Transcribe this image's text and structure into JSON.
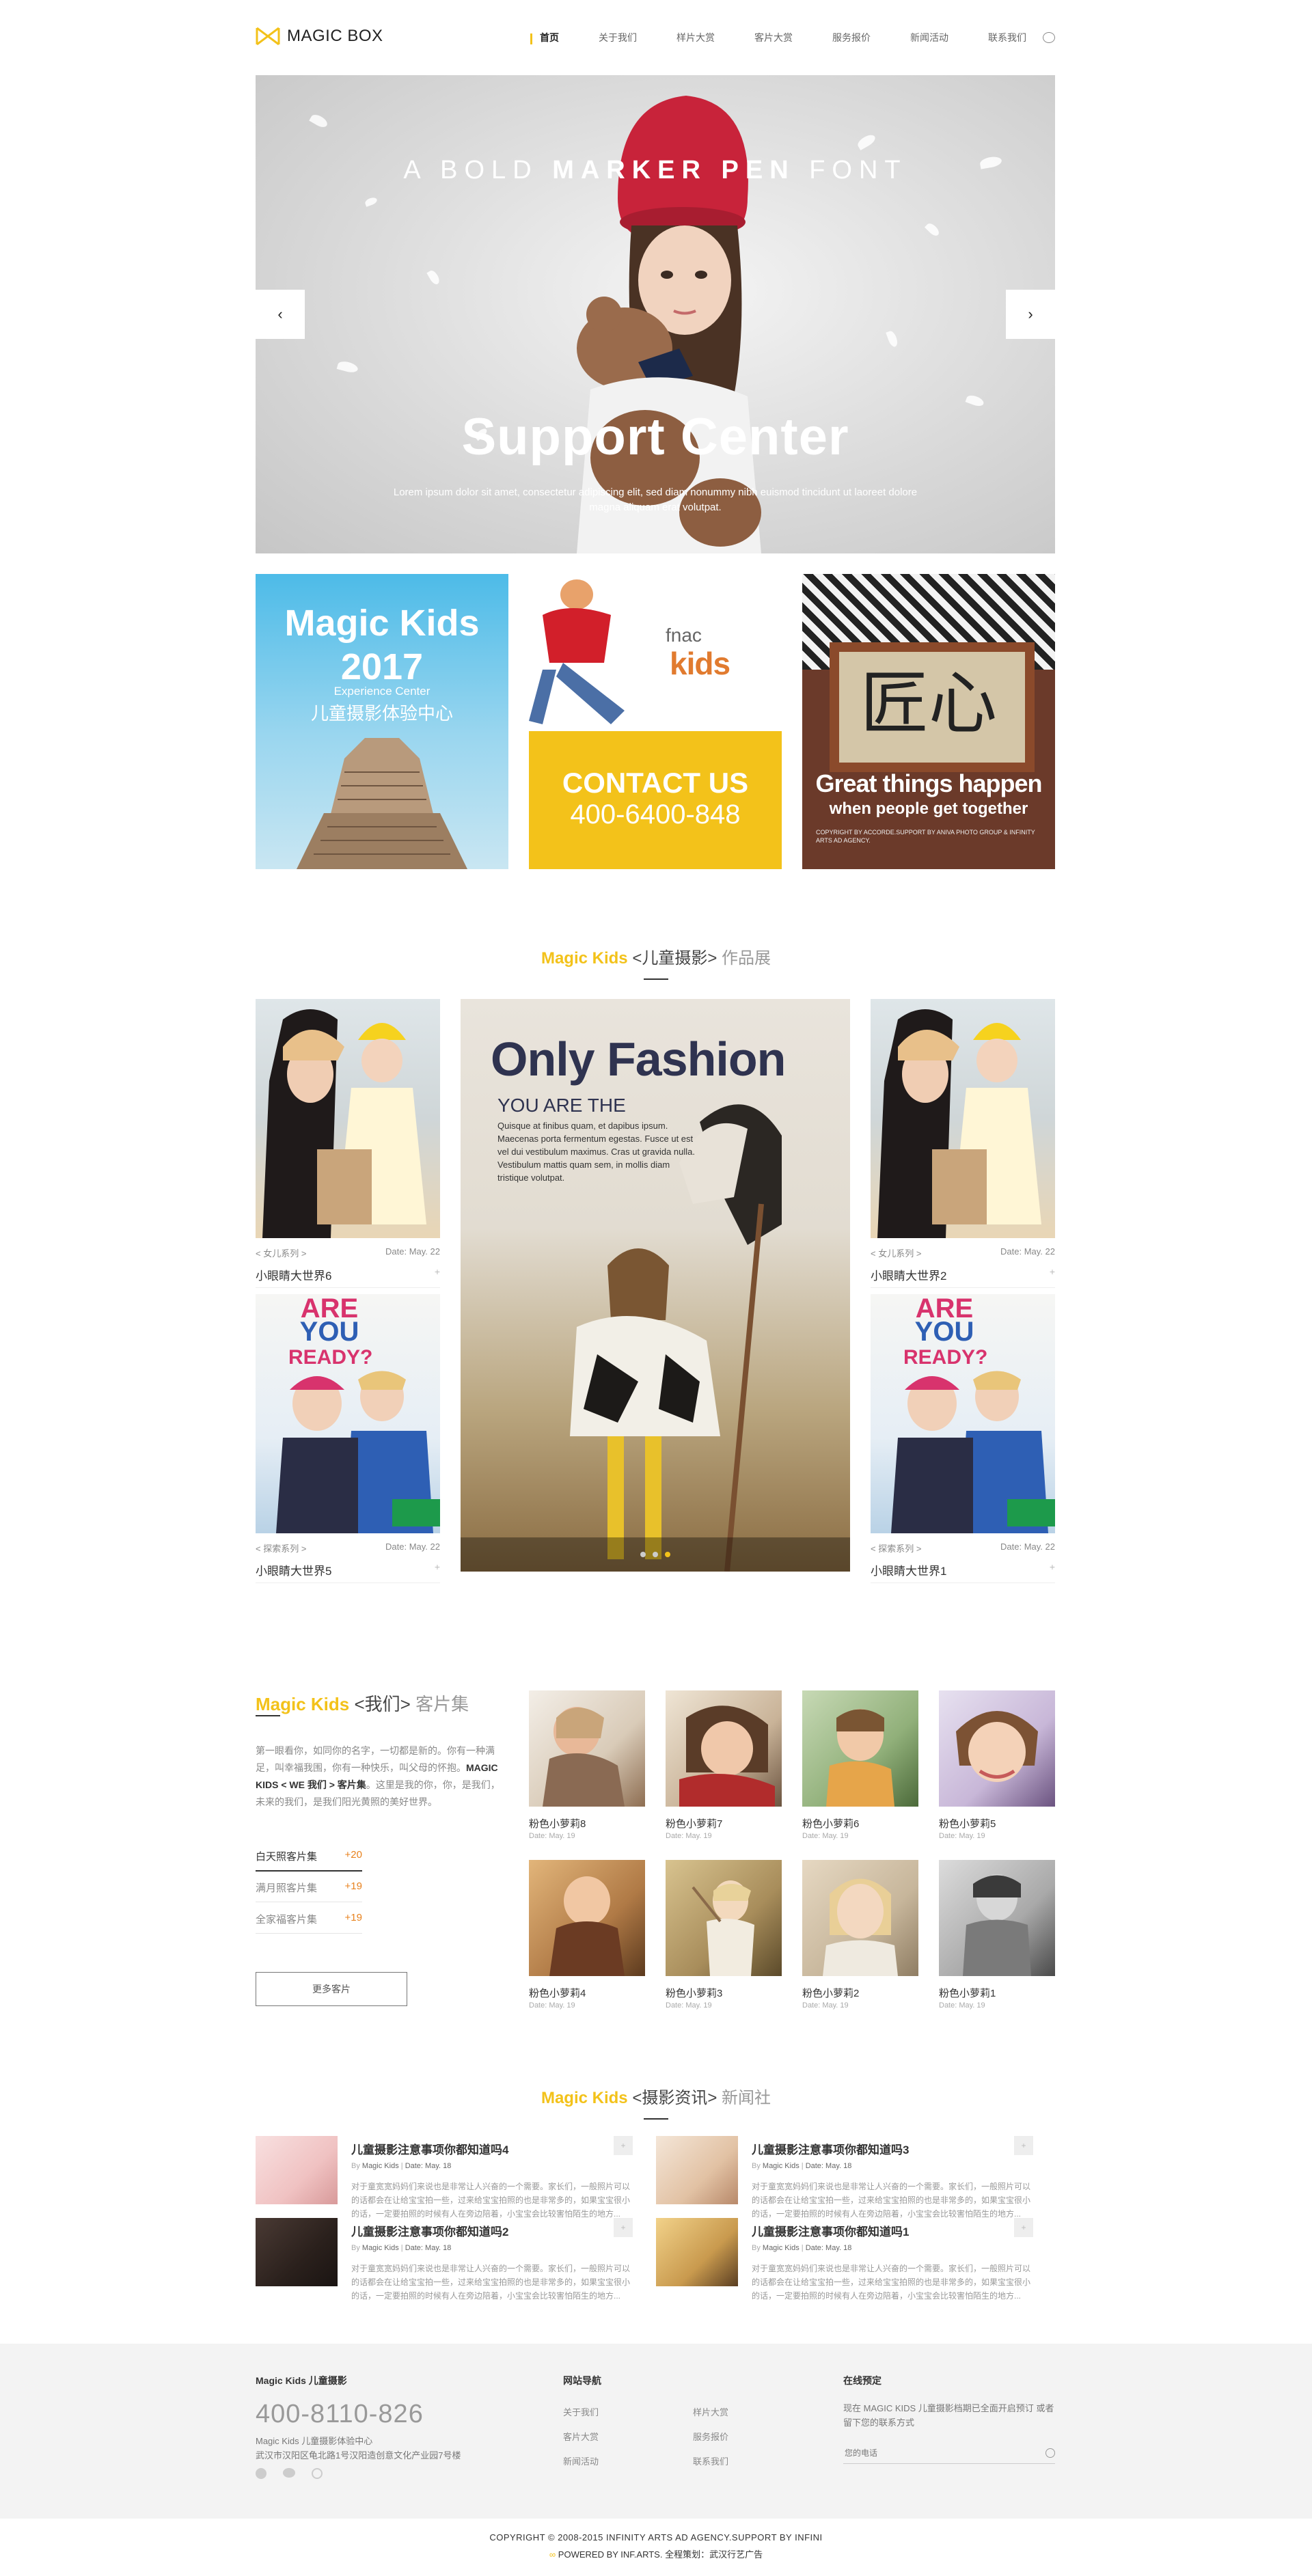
{
  "header": {
    "logo_text": "MAGIC BOX",
    "nav": [
      "首页",
      "关于我们",
      "样片大赏",
      "客片大赏",
      "服务报价",
      "新闻活动",
      "联系我们"
    ]
  },
  "hero": {
    "kicker_light": "A BOLD ",
    "kicker_bold": "MARKER PEN",
    "kicker_end": " FONT",
    "title": "Support Center",
    "text": "Lorem ipsum dolor sit amet, consectetur adipiscing elit, sed diam nonummy nibh euismod tincidunt ut laoreet dolore magna aliquam erat volutpat.",
    "prev": "‹",
    "next": "›"
  },
  "tiles": {
    "t1_line1": "Magic Kids",
    "t1_line2": "2017",
    "t1_sub_en": "Experience Center",
    "t1_sub_cn": "儿童摄影体验中心",
    "t2_brand": "fnac",
    "t2_kids": "kids",
    "t2_cta": "CONTACT US",
    "t2_phone": "400-6400-848",
    "t3_cn": "匠心",
    "t3_line1": "Great things happen",
    "t3_line2": "when people get together",
    "t3_small": "COPYRIGHT BY ACCORDE.SUPPORT BY ANIVA PHOTO GROUP & INFINITY ARTS AD AGENCY."
  },
  "portfolio": {
    "heading_y": "Magic Kids",
    "heading_m": " <儿童摄影> ",
    "heading_g": "作品展",
    "cards": [
      {
        "series": "< 女儿系列 >",
        "date": "Date: May. 22",
        "name": "小眼睛大世界6",
        "plus": "+"
      },
      {
        "series": "< 女儿系列 >",
        "date": "Date: May. 22",
        "name": "小眼睛大世界2",
        "plus": "+"
      },
      {
        "series": "< 探索系列 >",
        "date": "Date: May. 22",
        "name": "小眼睛大世界5",
        "plus": "+"
      },
      {
        "series": "< 探索系列 >",
        "date": "Date: May. 22",
        "name": "小眼睛大世界1",
        "plus": "+"
      }
    ],
    "feature_title": "Only Fashion",
    "feature_sub": "YOU ARE THE",
    "feature_text": "Quisque at finibus quam, et dapibus ipsum. Maecenas porta fermentum egestas. Fusce ut est vel dui vestibulum maximus. Cras ut gravida nulla. Vestibulum mattis quam sem, in mollis diam tristique volutpat.",
    "poster_line1": "ARE",
    "poster_line2": "YOU",
    "poster_line3": "READY?"
  },
  "gallery": {
    "heading_y": "Magic Kids",
    "heading_m": " <我们> ",
    "heading_g": "客片集",
    "desc_pre": "第一眼看你，如同你的名字，一切都是新的。你有一种满足，叫幸福我围，你有一种快乐，叫父母的怀抱。",
    "desc_bold": "MAGIC KIDS < WE 我们 > 客片集",
    "desc_post": "。这里是我的你，你，是我们，未来的我们，是我们阳光黄照的美好世界。",
    "stats": [
      {
        "label": "白天照客片集",
        "num": "+20"
      },
      {
        "label": "满月照客片集",
        "num": "+19"
      },
      {
        "label": "全家福客片集",
        "num": "+19"
      }
    ],
    "more": "更多客片",
    "thumbs": [
      {
        "name": "粉色小萝莉8",
        "date": "Date: May. 19"
      },
      {
        "name": "粉色小萝莉7",
        "date": "Date: May. 19"
      },
      {
        "name": "粉色小萝莉6",
        "date": "Date: May. 19"
      },
      {
        "name": "粉色小萝莉5",
        "date": "Date: May. 19"
      },
      {
        "name": "粉色小萝莉4",
        "date": "Date: May. 19"
      },
      {
        "name": "粉色小萝莉3",
        "date": "Date: May. 19"
      },
      {
        "name": "粉色小萝莉2",
        "date": "Date: May. 19"
      },
      {
        "name": "粉色小萝莉1",
        "date": "Date: May. 19"
      }
    ]
  },
  "news": {
    "heading_y": "Magic Kids",
    "heading_m": " <摄影资讯> ",
    "heading_g": "新闻社",
    "items": [
      {
        "title": "儿童摄影注意事项你都知道吗4",
        "by": "By ",
        "author": "Magic Kids",
        "sep": "  |  ",
        "date": "Date: May. 18",
        "desc": "对于童宽宽妈妈们来说也是非常让人兴奋的一个需要。家长们，一般照片可以的话都会在让给宝宝拍一些，过来给宝宝拍照的也是非常多的，如果宝宝很小的话，一定要拍照的时候有人在旁边陪着，小宝宝会比较害怕陌生的地方..."
      },
      {
        "title": "儿童摄影注意事项你都知道吗3",
        "by": "By ",
        "author": "Magic Kids",
        "sep": "  |  ",
        "date": "Date: May. 18",
        "desc": "对于童宽宽妈妈们来说也是非常让人兴奋的一个需要。家长们，一般照片可以的话都会在让给宝宝拍一些，过来给宝宝拍照的也是非常多的，如果宝宝很小的话，一定要拍照的时候有人在旁边陪着，小宝宝会比较害怕陌生的地方..."
      },
      {
        "title": "儿童摄影注意事项你都知道吗2",
        "by": "By ",
        "author": "Magic Kids",
        "sep": "  |  ",
        "date": "Date: May. 18",
        "desc": "对于童宽宽妈妈们来说也是非常让人兴奋的一个需要。家长们，一般照片可以的话都会在让给宝宝拍一些，过来给宝宝拍照的也是非常多的，如果宝宝很小的话，一定要拍照的时候有人在旁边陪着，小宝宝会比较害怕陌生的地方..."
      },
      {
        "title": "儿童摄影注意事项你都知道吗1",
        "by": "By ",
        "author": "Magic Kids",
        "sep": "  |  ",
        "date": "Date: May. 18",
        "desc": "对于童宽宽妈妈们来说也是非常让人兴奋的一个需要。家长们，一般照片可以的话都会在让给宝宝拍一些，过来给宝宝拍照的也是非常多的，如果宝宝很小的话，一定要拍照的时候有人在旁边陪着，小宝宝会比较害怕陌生的地方..."
      }
    ],
    "more_btn": "+"
  },
  "footer": {
    "col1_title": "Magic Kids 儿童摄影",
    "phone": "400-8110-826",
    "addr1": "Magic Kids 儿童摄影体验中心",
    "addr2": "武汉市汉阳区龟北路1号汉阳造创意文化产业园7号楼",
    "col2_title": "网站导航",
    "links": [
      "关于我们",
      "样片大赏",
      "客片大赏",
      "服务报价",
      "新闻活动",
      "联系我们"
    ],
    "col3_title": "在线预定",
    "col3_text": "现在 MAGIC KIDS 儿童摄影档期已全面开启预订 或者留下您的联系方式",
    "phone_placeholder": "您的电话",
    "copyright": "COPYRIGHT © 2008-2015 INFINITY ARTS AD AGENCY.SUPPORT BY INFINI",
    "powered": "POWERED BY INF.ARTS. 全程策划：武汉行艺广告"
  }
}
